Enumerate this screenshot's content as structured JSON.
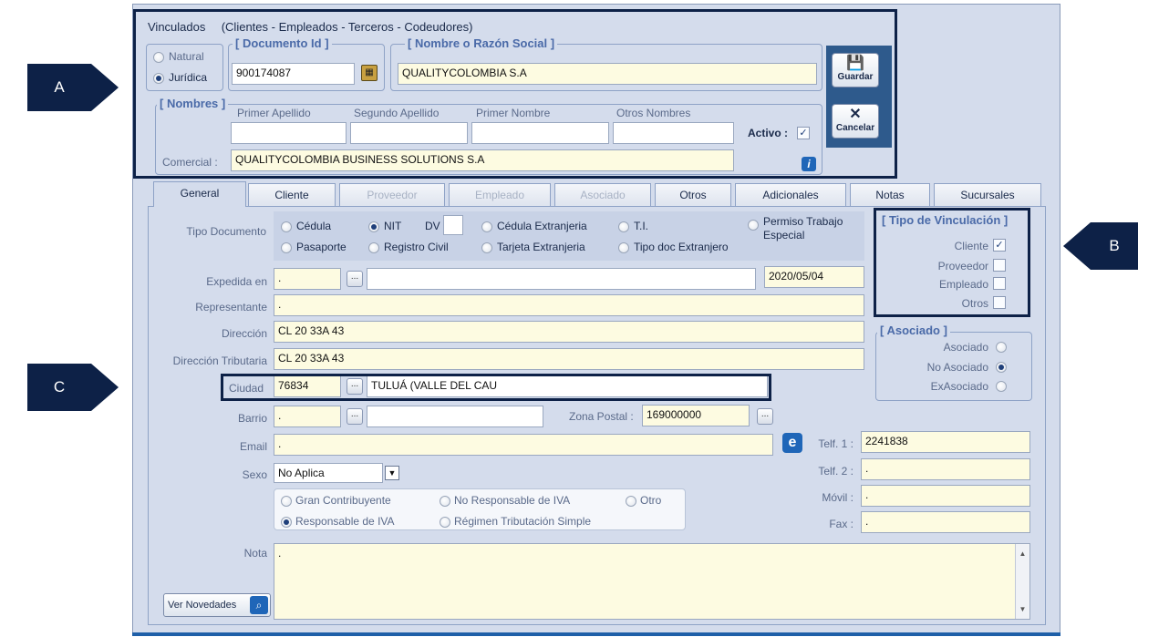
{
  "window": {
    "title": "Vinculados",
    "subtitle": "(Clientes - Empleados - Terceros - Codeudores)"
  },
  "persona": {
    "natural_label": "Natural",
    "juridica_label": "Jurídica",
    "selected": "Jurídica"
  },
  "documento": {
    "legend": "[ Documento Id ]",
    "value": "900174087"
  },
  "razon_social": {
    "legend": "[ Nombre o Razón Social ]",
    "value": "QUALITYCOLOMBIA S.A"
  },
  "nombres": {
    "legend": "[ Nombres ]",
    "primer_apellido_label": "Primer Apellido",
    "segundo_apellido_label": "Segundo Apellido",
    "primer_nombre_label": "Primer Nombre",
    "otros_nombres_label": "Otros Nombres",
    "activo_label": "Activo :",
    "activo_mark": "✓",
    "comercial_label": "Comercial :",
    "comercial_value": "QUALITYCOLOMBIA BUSINESS SOLUTIONS S.A"
  },
  "actions": {
    "guardar": "Guardar",
    "cancelar": "Cancelar",
    "info_glyph": "i"
  },
  "tabs": [
    {
      "label": "General",
      "state": "active"
    },
    {
      "label": "Cliente",
      "state": "enabled"
    },
    {
      "label": "Proveedor",
      "state": "disabled"
    },
    {
      "label": "Empleado",
      "state": "disabled"
    },
    {
      "label": "Asociado",
      "state": "disabled"
    },
    {
      "label": "Otros",
      "state": "enabled"
    },
    {
      "label": "Adicionales",
      "state": "enabled"
    },
    {
      "label": "Notas",
      "state": "enabled"
    },
    {
      "label": "Sucursales",
      "state": "enabled"
    }
  ],
  "tipo_documento": {
    "label": "Tipo Documento",
    "dv_label": "DV",
    "options": [
      "Cédula",
      "NIT",
      "Cédula Extranjeria",
      "T.I.",
      "Permiso Trabajo",
      "Especial",
      "Pasaporte",
      "Registro Civil",
      "Tarjeta Extranjeria",
      "Tipo doc Extranjero"
    ],
    "selected": "NIT"
  },
  "general": {
    "expedida_label": "Expedida en",
    "expedida_code": ".",
    "expedida_date": "2020/05/04",
    "representante_label": "Representante",
    "representante_value": ".",
    "direccion_label": "Dirección",
    "direccion_value": "CL 20 33A 43",
    "direccion_trib_label": "Dirección Tributaria",
    "direccion_trib_value": "CL 20 33A 43",
    "ciudad_label": "Ciudad",
    "ciudad_code": "76834",
    "ciudad_name": "TULUÁ (VALLE DEL CAU",
    "barrio_label": "Barrio",
    "barrio_code": ".",
    "zona_postal_label": "Zona Postal :",
    "zona_postal_value": "169000000",
    "email_label": "Email",
    "email_value": ".",
    "sexo_label": "Sexo",
    "sexo_value": "No Aplica",
    "nota_label": "Nota",
    "nota_value": ".",
    "ver_novedades": "Ver Novedades",
    "ellipsis": "..."
  },
  "regimen": {
    "options": [
      "Gran Contribuyente",
      "No Responsable de IVA",
      "Otro",
      "Responsable de IVA",
      "Régimen Tributación Simple"
    ],
    "selected": "Responsable de IVA"
  },
  "telefonos": {
    "telf1_label": "Telf. 1 :",
    "telf1_value": "2241838",
    "telf2_label": "Telf. 2 :",
    "telf2_value": ".",
    "movil_label": "Móvil :",
    "movil_value": ".",
    "fax_label": "Fax :",
    "fax_value": "."
  },
  "tipo_vinculacion": {
    "legend": "[ Tipo de Vinculación ]",
    "items": [
      {
        "label": "Cliente",
        "checked": true
      },
      {
        "label": "Proveedor",
        "checked": false
      },
      {
        "label": "Empleado",
        "checked": false
      },
      {
        "label": "Otros",
        "checked": false
      }
    ],
    "check_mark": "✓"
  },
  "asociado": {
    "legend": "[ Asociado ]",
    "options": [
      "Asociado",
      "No Asociado",
      "ExAsociado"
    ],
    "selected": "No Asociado"
  },
  "callouts": {
    "a": "A",
    "b": "B",
    "c": "C"
  },
  "colors": {
    "highlight": "#0d2147",
    "panel": "#d4dcec",
    "field": "#fdfbe1",
    "accent": "#1f66b8"
  }
}
